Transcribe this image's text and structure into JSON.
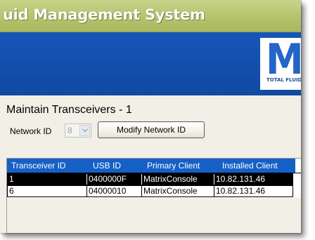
{
  "window": {
    "title": "uid Management System"
  },
  "banner": {
    "logo_text": "Ma",
    "logo_tagline": "TOTAL FLUID I"
  },
  "page": {
    "heading": "Maintain Transceivers - 1"
  },
  "network": {
    "label": "Network ID",
    "selected_value": "8",
    "modify_button_label": "Modify Network ID"
  },
  "table": {
    "columns": [
      "Transceiver ID",
      "USB ID",
      "Primary Client",
      "Installed Client"
    ],
    "rows": [
      {
        "transceiver_id": "1",
        "usb_id": "0400000F",
        "primary_client": "MatrixConsole",
        "installed_client": "10.82.131.46",
        "selected": true
      },
      {
        "transceiver_id": "6",
        "usb_id": "04000010",
        "primary_client": "MatrixConsole",
        "installed_client": "10.82.131.46",
        "selected": false
      }
    ]
  },
  "colors": {
    "titlebar": "#b4c36c",
    "banner": "#1350ad",
    "grid_header": "#1560c6",
    "selected_row": "#000000"
  }
}
